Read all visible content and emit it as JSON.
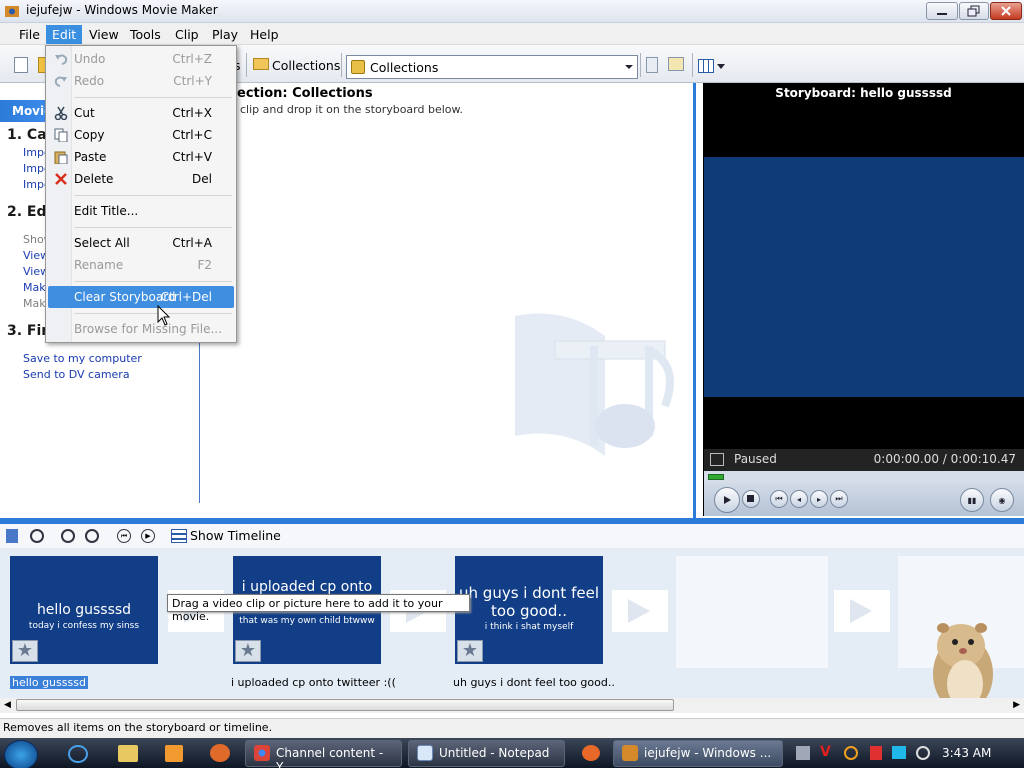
{
  "window": {
    "title": "iejufejw - Windows Movie Maker"
  },
  "menu": [
    "File",
    "Edit",
    "View",
    "Tools",
    "Clip",
    "Play",
    "Help"
  ],
  "edit_menu": {
    "items": [
      {
        "label": "Undo",
        "shortcut": "Ctrl+Z",
        "disabled": true,
        "icon": "undo-icon"
      },
      {
        "label": "Redo",
        "shortcut": "Ctrl+Y",
        "disabled": true,
        "icon": "redo-icon"
      },
      {
        "label": "Cut",
        "shortcut": "Ctrl+X",
        "disabled": false,
        "icon": "scissors-icon"
      },
      {
        "label": "Copy",
        "shortcut": "Ctrl+C",
        "disabled": false,
        "icon": "copy-icon"
      },
      {
        "label": "Paste",
        "shortcut": "Ctrl+V",
        "disabled": false,
        "icon": "paste-icon"
      },
      {
        "label": "Delete",
        "shortcut": "Del",
        "disabled": false,
        "icon": "delete-x-icon"
      },
      {
        "label": "Edit Title...",
        "shortcut": "",
        "disabled": false
      },
      {
        "label": "Select All",
        "shortcut": "Ctrl+A",
        "disabled": false
      },
      {
        "label": "Rename",
        "shortcut": "F2",
        "disabled": true
      },
      {
        "label": "Clear Storyboard",
        "shortcut": "Ctrl+Del",
        "disabled": false,
        "highlighted": true
      },
      {
        "label": "Browse for Missing File...",
        "shortcut": "",
        "disabled": true
      }
    ]
  },
  "toolbar": {
    "collections_button": "Collections",
    "collections_combo": "Collections",
    "partial_button": "s"
  },
  "taskpane": {
    "header": "Movie",
    "sections": [
      {
        "title": "1. Cap",
        "links": [
          "Impo",
          "Impo",
          "Impo"
        ]
      },
      {
        "title": "2. Edi",
        "links": [
          "Show",
          "View",
          "View",
          "Make",
          "Make"
        ]
      },
      {
        "title": "3. Fini",
        "links": [
          "Save to my computer",
          "Send to DV camera"
        ]
      }
    ]
  },
  "collection": {
    "title": "ection: Collections",
    "subtitle": "clip and drop it on the storyboard below."
  },
  "preview": {
    "title": "Storyboard: hello gussssd",
    "state": "Paused",
    "time": "0:00:00.00 / 0:00:10.47",
    "progress_fraction": 0.03
  },
  "storyboard_toolbar": {
    "show_timeline": "Show Timeline"
  },
  "clips": [
    {
      "title": "hello gussssd",
      "subtitle": "today i confess my sinss",
      "caption": "hello gussssd"
    },
    {
      "title": "i uploaded cp onto twitteer :((",
      "subtitle": "that was my own child btwww",
      "caption": "i uploaded cp onto twitteer :(("
    },
    {
      "title": "uh guys i dont feel too good..",
      "subtitle": "i think i shat myself",
      "caption": "uh guys i dont feel too good.."
    }
  ],
  "tooltip": "Drag a video clip or picture here to add it to your movie.",
  "statusbar": "Removes all items on the storyboard or timeline.",
  "taskbar": {
    "tasks": [
      {
        "label": "Channel content - Y...",
        "active": false
      },
      {
        "label": "Untitled - Notepad",
        "active": false
      },
      {
        "label": "iejufejw - Windows ...",
        "active": true
      }
    ],
    "clock": "3:43 AM"
  },
  "colors": {
    "accent": "#2c7bd8",
    "highlight": "#3f8ee0",
    "storyboard_clip": "#113e86"
  }
}
